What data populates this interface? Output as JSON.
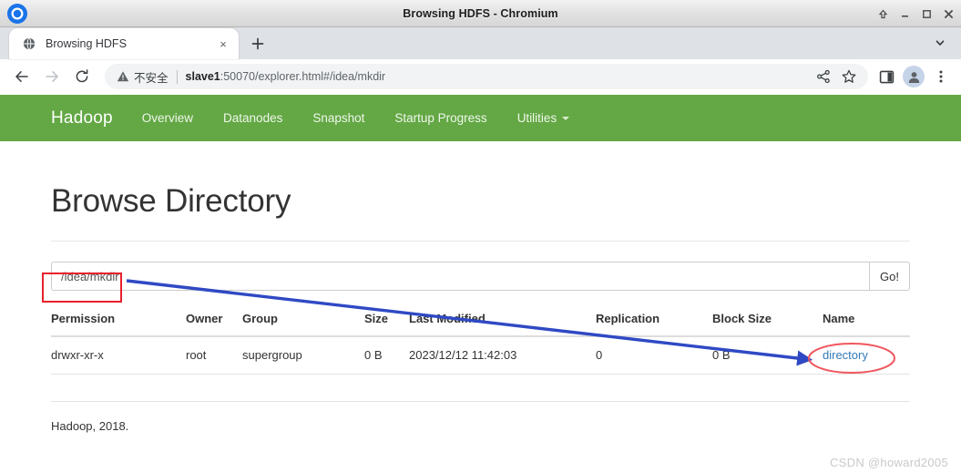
{
  "window": {
    "title": "Browsing HDFS - Chromium",
    "controls": [
      "shade-button",
      "minimize-button",
      "maximize-button",
      "close-button"
    ]
  },
  "tabs": [
    {
      "title": "Browsing HDFS",
      "favicon": "globe-icon",
      "active": true
    }
  ],
  "tabstrip": {
    "new_tab_label": "+",
    "tab_close_label": "×",
    "tab_list_chevron": "chevron-down-icon"
  },
  "toolbar": {
    "back": "back-arrow-icon",
    "forward": "forward-arrow-icon",
    "reload": "reload-icon",
    "security_label": "不安全",
    "url_host": "slave1",
    "url_rest": ":50070/explorer.html#/idea/mkdir",
    "url_full": "slave1:50070/explorer.html#/idea/mkdir",
    "share_icon": "share-icon",
    "bookmark_icon": "star-icon",
    "side_panel_icon": "side-panel-icon",
    "profile_icon": "profile-avatar-icon",
    "menu_icon": "three-dot-menu-icon"
  },
  "hadoop": {
    "brand": "Hadoop",
    "nav": [
      {
        "label": "Overview",
        "dropdown": false
      },
      {
        "label": "Datanodes",
        "dropdown": false
      },
      {
        "label": "Snapshot",
        "dropdown": false
      },
      {
        "label": "Startup Progress",
        "dropdown": false
      },
      {
        "label": "Utilities",
        "dropdown": true
      }
    ],
    "navbar_color": "#63a844"
  },
  "page": {
    "title": "Browse Directory",
    "path_input_value": "/idea/mkdir",
    "path_input_placeholder": "",
    "go_label": "Go!",
    "table": {
      "headers": [
        "Permission",
        "Owner",
        "Group",
        "Size",
        "Last Modified",
        "Replication",
        "Block Size",
        "Name"
      ],
      "rows": [
        {
          "permission": "drwxr-xr-x",
          "owner": "root",
          "group": "supergroup",
          "size": "0 B",
          "last_modified": "2023/12/12 11:42:03",
          "replication": "0",
          "block_size": "0 B",
          "name": "directory"
        }
      ]
    },
    "footer": "Hadoop, 2018."
  },
  "annotations": {
    "highlight_box_color": "#e8212c",
    "ellipse_color": "#f0585f",
    "arrow_color": "#2f49c4",
    "watermark": "CSDN @howard2005"
  }
}
